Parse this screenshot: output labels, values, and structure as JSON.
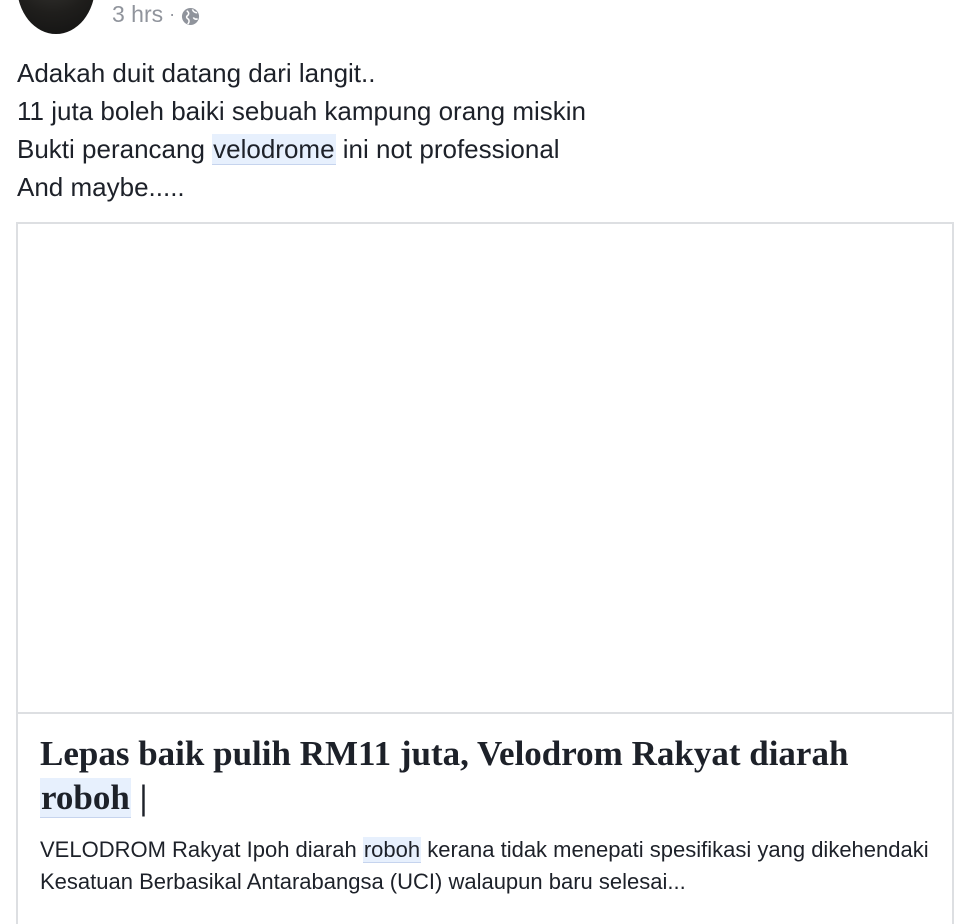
{
  "post": {
    "timestamp": "3 hrs",
    "separator": "·",
    "privacy_icon": "globe-icon",
    "lines": [
      {
        "text": "Adakah duit datang dari langit.."
      },
      {
        "text": "11 juta boleh baiki sebuah kampung orang miskin"
      },
      {
        "before": "Bukti perancang ",
        "tag": "velodrome",
        "after": " ini not professional"
      },
      {
        "text": "And maybe....."
      }
    ]
  },
  "link_card": {
    "title_before": "Lepas baik pulih RM11 juta, Velodrom Rakyat diarah ",
    "title_tag": "roboh",
    "title_after": " |",
    "desc_before": "VELODROM Rakyat Ipoh diarah ",
    "desc_tag": "roboh",
    "desc_after": " kerana tidak menepati spesifikasi yang dikehendaki Kesatuan Berbasikal Antarabangsa (UCI) walaupun baru selesai..."
  },
  "colors": {
    "text": "#1d2129",
    "meta": "#90949c",
    "highlight_bg": "#e7f0fd",
    "border": "#dddfe2"
  }
}
